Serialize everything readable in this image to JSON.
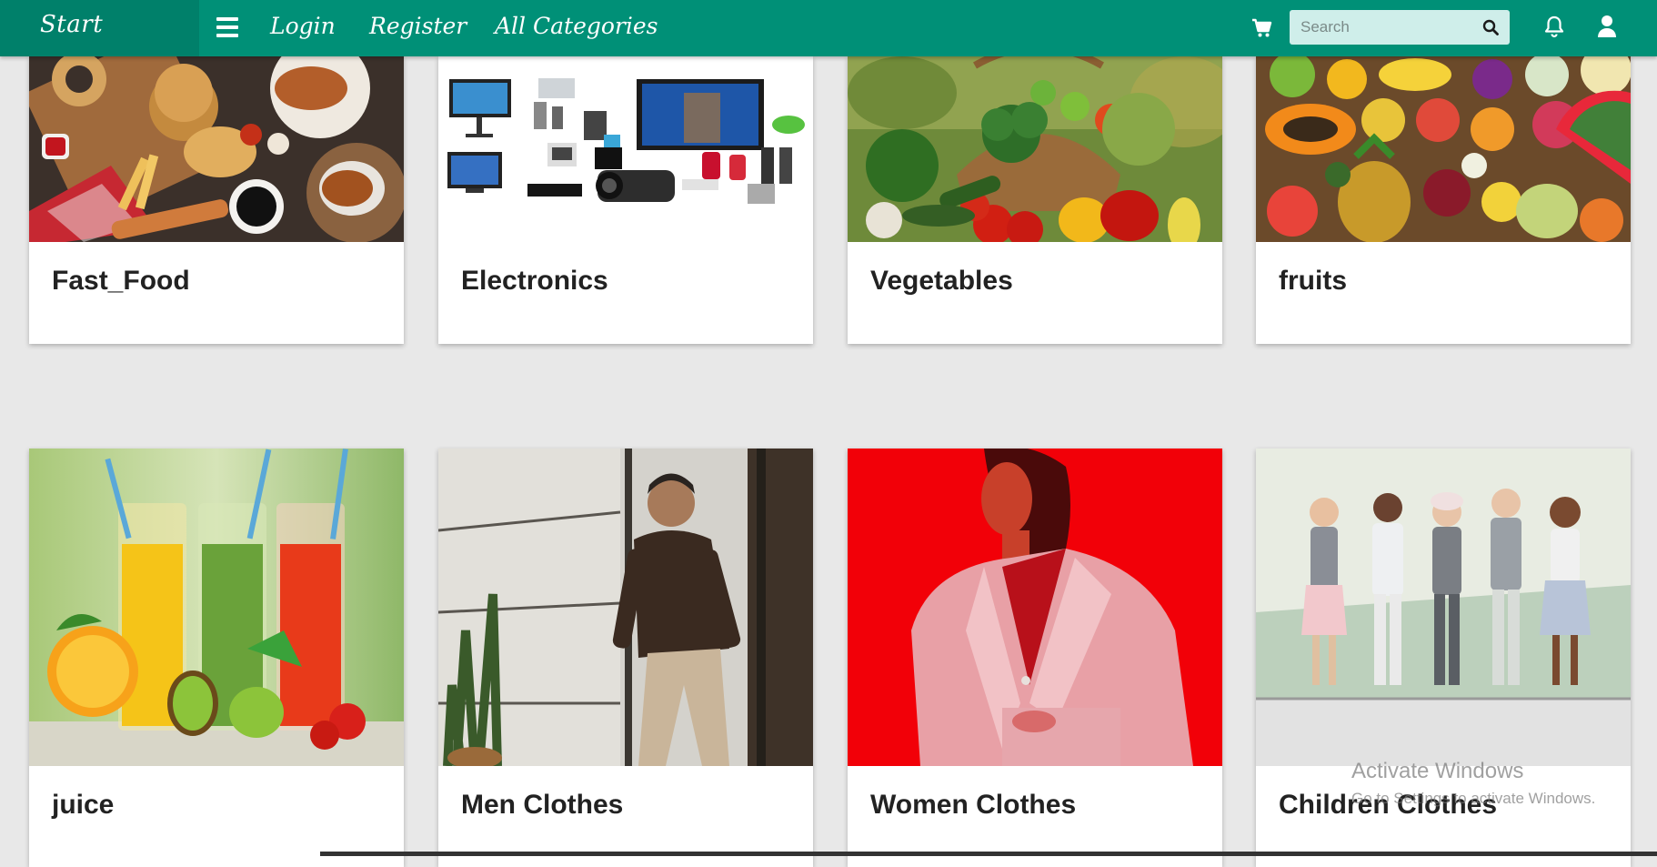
{
  "navbar": {
    "brand": "Start",
    "menu_icon": "hamburger-icon",
    "links": [
      "Login",
      "Register",
      "All Categories"
    ],
    "search": {
      "placeholder": "Search",
      "value": ""
    },
    "icons": [
      "cart-icon",
      "search-icon",
      "bell-icon",
      "user-icon"
    ],
    "colors": {
      "bar": "#009077",
      "brand_box": "#00806a",
      "search_bg": "#cfeeea"
    }
  },
  "categories": [
    {
      "name": "Fast_Food"
    },
    {
      "name": "Electronics"
    },
    {
      "name": "Vegetables"
    },
    {
      "name": "fruits"
    },
    {
      "name": "juice"
    },
    {
      "name": "Men Clothes"
    },
    {
      "name": "Women Clothes"
    },
    {
      "name": "Children Clothes"
    }
  ],
  "watermark": {
    "title": "Activate Windows",
    "subtitle": "Go to Settings to activate Windows."
  }
}
